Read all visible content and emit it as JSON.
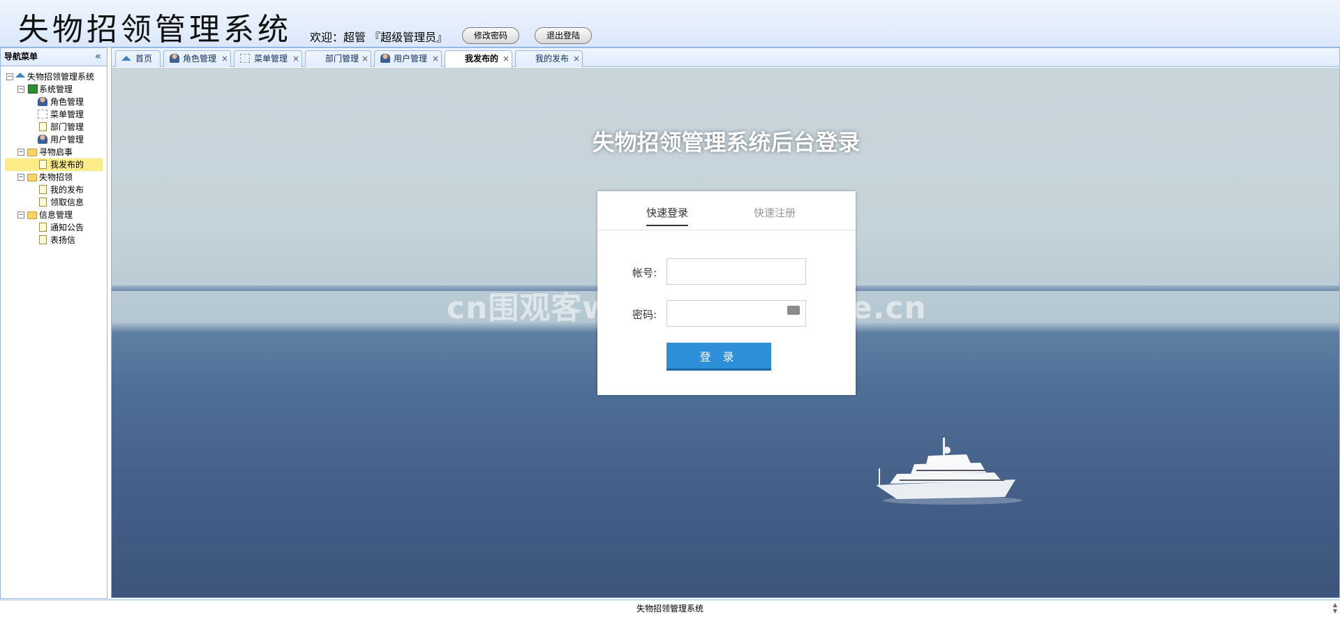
{
  "header": {
    "app_title": "失物招领管理系统",
    "welcome": "欢迎：超管 『超级管理员』",
    "change_password_label": "修改密码",
    "logout_label": "退出登陆"
  },
  "sidebar": {
    "title": "导航菜单",
    "collapse_icon": "double-chevron-left-icon",
    "tree": {
      "root": "失物招领管理系统",
      "groups": [
        {
          "label": "系统管理",
          "items": [
            "角色管理",
            "菜单管理",
            "部门管理",
            "用户管理"
          ]
        },
        {
          "label": "寻物启事",
          "items": [
            "我发布的"
          ]
        },
        {
          "label": "失物招领",
          "items": [
            "我的发布",
            "领取信息"
          ]
        },
        {
          "label": "信息管理",
          "items": [
            "通知公告",
            "表扬信"
          ]
        }
      ],
      "selected": "我发布的"
    }
  },
  "tabs": [
    {
      "label": "首页",
      "icon": "home-icon",
      "closable": false
    },
    {
      "label": "角色管理",
      "icon": "user-icon",
      "closable": true
    },
    {
      "label": "菜单管理",
      "icon": "tree-icon",
      "closable": true
    },
    {
      "label": "部门管理",
      "icon": "",
      "closable": true
    },
    {
      "label": "用户管理",
      "icon": "user-icon",
      "closable": true
    },
    {
      "label": "我发布的",
      "icon": "",
      "closable": true,
      "active": true
    },
    {
      "label": "我的发布",
      "icon": "",
      "closable": true
    }
  ],
  "login": {
    "title": "失物招领管理系统后台登录",
    "tab_login": "快速登录",
    "tab_register": "快速注册",
    "account_label": "帐号:",
    "password_label": "密码:",
    "account_value": "",
    "password_value": "",
    "submit_label": "登 录"
  },
  "watermark": "cn围观客www.weiguanke.cn",
  "footer": "失物招领管理系统",
  "colors": {
    "accent": "#2e8fd9",
    "border": "#95b8e7",
    "selected": "#fbec88"
  }
}
